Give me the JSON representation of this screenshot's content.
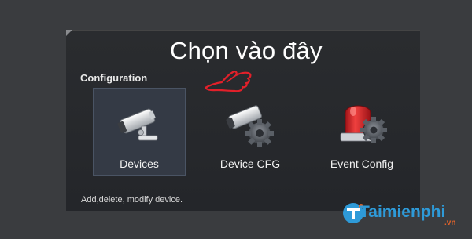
{
  "overlay_title": "Chọn vào đây",
  "section": {
    "label": "Configuration"
  },
  "tiles": [
    {
      "label": "Devices",
      "icon": "camera-icon",
      "selected": true
    },
    {
      "label": "Device CFG",
      "icon": "camera-gear-icon",
      "selected": false
    },
    {
      "label": "Event Config",
      "icon": "alarm-gear-icon",
      "selected": false
    }
  ],
  "description": "Add,delete, modify device.",
  "watermark": {
    "text": "Taimienphi",
    "suffix": ".vn"
  },
  "colors": {
    "background": "#3a3c3f",
    "panel": "#26282c",
    "selected_tile": "#343a45",
    "hand_annotation": "#e2202a",
    "alarm_red": "#d8262a",
    "watermark_blue": "#2e9ad8"
  }
}
